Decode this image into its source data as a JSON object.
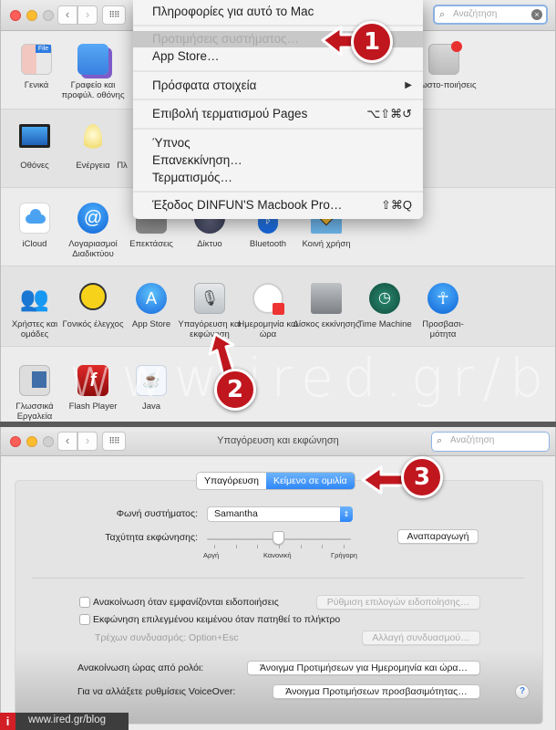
{
  "overview_window": {
    "search": {
      "placeholder": "Αναζήτηση"
    },
    "nav": {
      "back": "‹",
      "forward": "›",
      "grid": "⠿⠿"
    },
    "rows": [
      {
        "items": [
          {
            "label": "Γενικά",
            "icon": "general-icon"
          },
          {
            "label": "Γραφείο και προφύλ. οθόνης",
            "icon": "desktop-screensaver-icon"
          },
          {
            "label": "Γνωστο-ποιήσεις",
            "icon": "notifications-icon"
          }
        ]
      },
      {
        "items": [
          {
            "label": "Οθόνες",
            "icon": "displays-icon"
          },
          {
            "label": "Ενέργεια",
            "icon": "energy-saver-icon"
          },
          {
            "label": "Πλ",
            "icon": "keyboard-icon"
          }
        ]
      },
      {
        "items": [
          {
            "label": "iCloud",
            "icon": "icloud-icon"
          },
          {
            "label": "Λογαριασμοί Διαδικτύου",
            "icon": "internet-accounts-icon"
          },
          {
            "label": "Επεκτάσεις",
            "icon": "extensions-icon"
          },
          {
            "label": "Δίκτυο",
            "icon": "network-icon"
          },
          {
            "label": "Bluetooth",
            "icon": "bluetooth-icon"
          },
          {
            "label": "Κοινή χρήση",
            "icon": "sharing-icon"
          }
        ]
      },
      {
        "items": [
          {
            "label": "Χρήστες και ομάδες",
            "icon": "users-groups-icon"
          },
          {
            "label": "Γονικός έλεγχος",
            "icon": "parental-controls-icon"
          },
          {
            "label": "App Store",
            "icon": "app-store-icon"
          },
          {
            "label": "Υπαγόρευση και εκφώνηση",
            "icon": "dictation-speech-icon"
          },
          {
            "label": "Ημερομηνία και ώρα",
            "icon": "date-time-icon"
          },
          {
            "label": "Δίσκος εκκίνησης",
            "icon": "startup-disk-icon"
          },
          {
            "label": "Time Machine",
            "icon": "time-machine-icon"
          },
          {
            "label": "Προσβασι-μότητα",
            "icon": "accessibility-icon"
          }
        ]
      },
      {
        "items": [
          {
            "label": "Γλωσσικά Εργαλεία",
            "icon": "language-tools-icon"
          },
          {
            "label": "Flash Player",
            "icon": "flash-player-icon"
          },
          {
            "label": "Java",
            "icon": "java-icon"
          }
        ]
      }
    ]
  },
  "apple_menu": {
    "items": [
      {
        "label": "Πληροφορίες για αυτό το Mac",
        "shortcut": ""
      },
      {
        "label": "Προτιμήσεις συστήματος…",
        "shortcut": "",
        "state": "highlighted"
      },
      {
        "label": "App Store…",
        "shortcut": ""
      },
      {
        "label": "Πρόσφατα στοιχεία",
        "shortcut": "▶"
      },
      {
        "label": "Επιβολή τερματισμού Pages",
        "shortcut": "⌥⇧⌘↺"
      },
      {
        "label": "Ύπνος",
        "shortcut": ""
      },
      {
        "label": "Επανεκκίνηση…",
        "shortcut": ""
      },
      {
        "label": "Τερματισμός…",
        "shortcut": ""
      },
      {
        "label": "Έξοδος DINFUN'S Macbook Pro…",
        "shortcut": "⇧⌘Q"
      }
    ]
  },
  "callouts": [
    "1",
    "2",
    "3"
  ],
  "watermark": "www.ired.gr/blog",
  "speech_window": {
    "title": "Υπαγόρευση και εκφώνηση",
    "search": {
      "placeholder": "Αναζήτηση"
    },
    "tabs": [
      {
        "label": "Υπαγόρευση",
        "selected": false
      },
      {
        "label": "Κείμενο σε ομιλία",
        "selected": true
      }
    ],
    "system_voice": {
      "label": "Φωνή συστήματος:",
      "value": "Samantha"
    },
    "speaking_rate": {
      "label": "Ταχύτητα εκφώνησης:",
      "value_fraction": 0.5,
      "tick_labels": [
        "Αργή",
        "Κανονική",
        "Γρήγορη"
      ]
    },
    "play_button": "Αναπαραγωγή",
    "announce_notifications": {
      "label": "Ανακοίνωση όταν εμφανίζονται ειδοποιήσεις",
      "checked": false,
      "button": "Ρύθμιση επιλογών ειδοποίησης…"
    },
    "speak_selected": {
      "label": "Εκφώνηση επιλεγμένου κειμένου όταν πατηθεί το πλήκτρο",
      "checked": false
    },
    "current_key": {
      "label": "Τρέχων συνδυασμός: Option+Esc",
      "button": "Αλλαγή συνδυασμού…"
    },
    "clock": {
      "label": "Ανακοίνωση ώρας από ρολόι:",
      "button": "Άνοιγμα Προτιμήσεων για Ημερομηνία και ώρα…"
    },
    "voiceover": {
      "label": "Για να αλλάξετε ρυθμίσεις VoiceOver:",
      "button": "Άνοιγμα Προτιμήσεων προσβασιμότητας…"
    },
    "help": "?"
  },
  "footer": {
    "logo": "i",
    "url": "www.ired.gr/blog"
  },
  "colors": {
    "callout_red": "#c0161e",
    "accent_blue": "#2f87f7",
    "menu_bg": "#f4f4f4",
    "footer_logo": "#d21f26"
  }
}
